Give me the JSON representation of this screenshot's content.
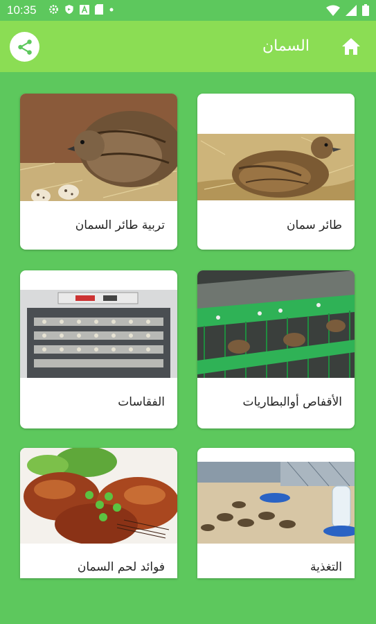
{
  "status_bar": {
    "time": "10:35"
  },
  "app_bar": {
    "title": "السمان"
  },
  "cards": [
    {
      "label": "طائر سمان"
    },
    {
      "label": "تربية طائر السمان"
    },
    {
      "label": "الأقفاص أوالبطاريات"
    },
    {
      "label": "الفقاسات"
    },
    {
      "label": "التغذية"
    },
    {
      "label": "فوائد لحم السمان"
    }
  ],
  "colors": {
    "background": "#5dc85d",
    "app_bar": "#8bdd54",
    "card": "#ffffff"
  },
  "icons": {
    "share": "share-icon",
    "home": "home-icon"
  }
}
